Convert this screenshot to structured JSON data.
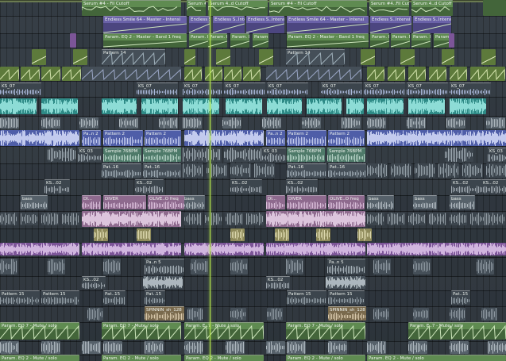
{
  "view": {
    "name": "playlist-arrangement",
    "playhead_label": ""
  },
  "colors": {
    "playhead": "#b6e84b",
    "automation": "#5f8b51",
    "automation_violet": "#6a62a8",
    "audio_teal": "#2e8a86",
    "audio_blue": "#4f5ea8",
    "pattern_olive": "#5d7a3b"
  },
  "clip_labels": {
    "serum_fil": "Serum #4 - Fil Cutoff",
    "serum_fil_short": "Serum #4..Fil Cutoff",
    "serum_fil_short2": "Serum 4..d Cutoff",
    "endless_smile": "Endless Smile 64 - Master - Intensi",
    "endless_smile_short": "Endless S..Intensi",
    "param_eq2": "Param. EQ 2 - Master - Band 1 freq",
    "param_eq2_short": "Param. E..d 1 freq",
    "pattern14": "Pattern 14",
    "ks07": "KS_07",
    "pattern2": "Pattern 2",
    "pa": "Pa..n 2",
    "ks03": "KS_03",
    "sample": "Sample 76BPM",
    "pat16": "Pat..16",
    "ks02": "KS...02",
    "bass": "bass",
    "diver": "DIVER",
    "diver_freq": "OLIVE..O freq",
    "dl": "Dl...",
    "pan5": "Pa..n 5",
    "pattern15": "Pattern 15",
    "pat15": "Pat..15",
    "spinnin": "SPINNIN_sh_128",
    "param_eq7": "Param. EQ 7 - Mute / solo",
    "param_eq7_short": "Param. E..7 - Mute / solo",
    "param_eq2b": "Param. EQ 2 - Mute / solo"
  }
}
